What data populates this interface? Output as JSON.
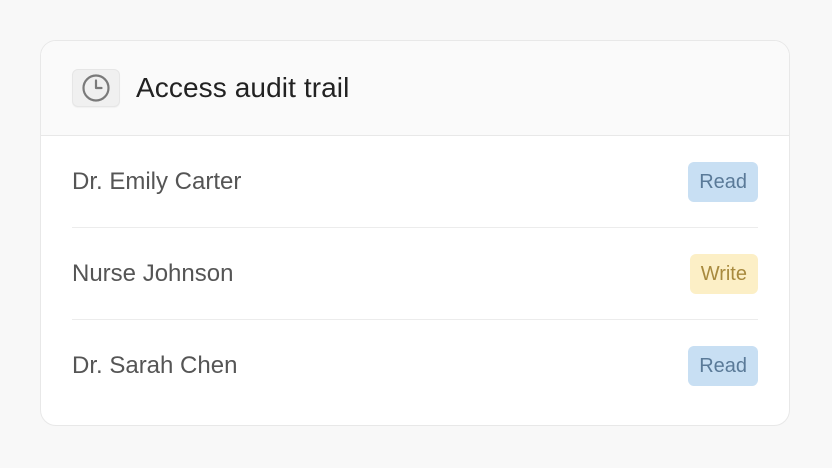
{
  "header": {
    "title": "Access audit trail",
    "icon": "clock-icon"
  },
  "entries": [
    {
      "name": "Dr. Emily Carter",
      "access": "Read",
      "access_type": "read"
    },
    {
      "name": "Nurse Johnson",
      "access": "Write",
      "access_type": "write"
    },
    {
      "name": "Dr. Sarah Chen",
      "access": "Read",
      "access_type": "read"
    }
  ],
  "colors": {
    "read_badge_bg": "#c8dff3",
    "read_badge_text": "#5a7a98",
    "write_badge_bg": "#fcefc6",
    "write_badge_text": "#a88a3e"
  }
}
